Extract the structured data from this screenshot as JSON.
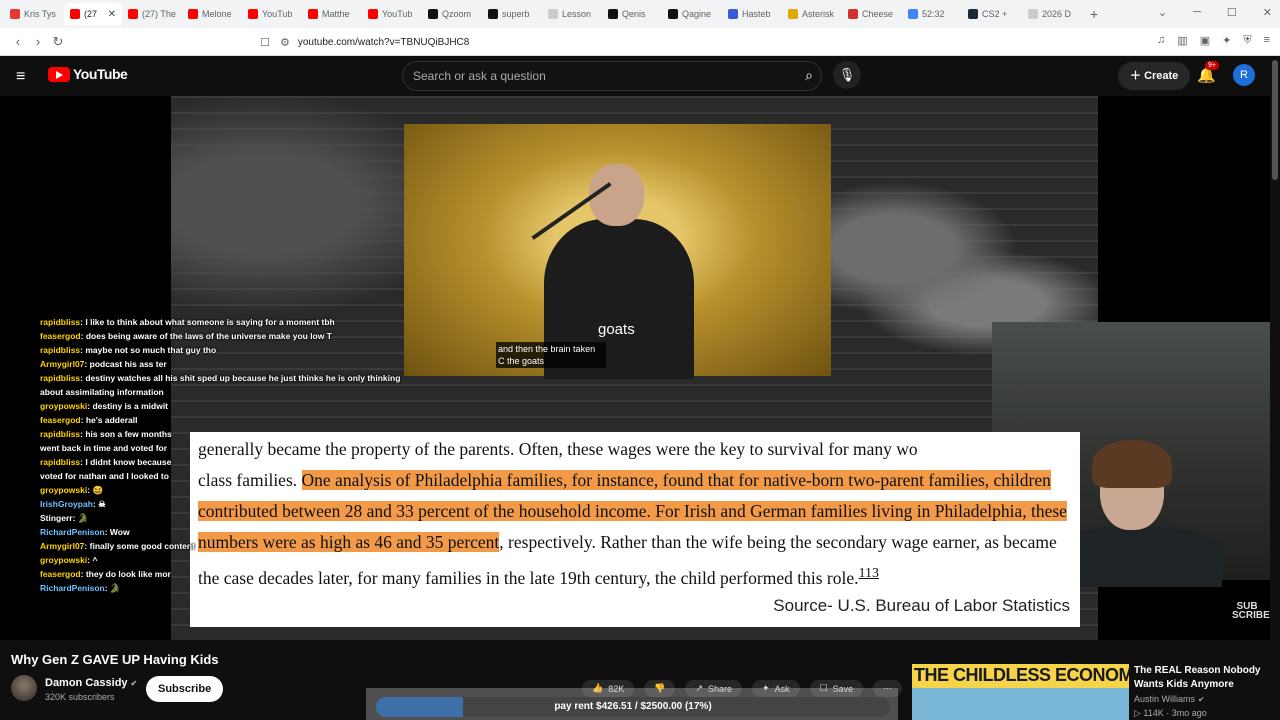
{
  "browser": {
    "tabs": [
      {
        "label": "Kris Tys",
        "color": "#e53935"
      },
      {
        "label": "(27",
        "color": "#ff0000",
        "active": true
      },
      {
        "label": "(27) The",
        "color": "#ff0000"
      },
      {
        "label": "Melone",
        "color": "#ff0000"
      },
      {
        "label": "YouTub",
        "color": "#ff0000"
      },
      {
        "label": "Matthe",
        "color": "#ff0000"
      },
      {
        "label": "YouTub",
        "color": "#ff0000"
      },
      {
        "label": "Qzoom",
        "color": "#111111"
      },
      {
        "label": "superb",
        "color": "#111111"
      },
      {
        "label": "Lesson",
        "color": "#cccccc"
      },
      {
        "label": "Qenis",
        "color": "#111111"
      },
      {
        "label": "Qagine",
        "color": "#111111"
      },
      {
        "label": "Hasteb",
        "color": "#3a5bd9"
      },
      {
        "label": "Asterisk",
        "color": "#e0a800"
      },
      {
        "label": "Cheese",
        "color": "#d32f2f"
      },
      {
        "label": "52:32",
        "color": "#4285f4"
      },
      {
        "label": "CS2 +",
        "color": "#1b2838"
      },
      {
        "label": "2026 D",
        "color": "#cccccc"
      }
    ],
    "url": "youtube.com/watch?v=TBNUQiBJHC8"
  },
  "header": {
    "logo": "YouTube",
    "search_placeholder": "Search or ask a question",
    "create_label": "Create",
    "notif_badge": "9+",
    "avatar_letter": "R"
  },
  "player": {
    "caption_word": "goats",
    "caption_small": "and then the brain taken C the goats",
    "doc": {
      "line1": "generally became the property of the parents. Often, these wages were the key to survival for many wo",
      "line2_pre": "class families. ",
      "highlight": "One analysis of Philadelphia families, for instance, found that for native-born two-parent families, children contributed between 28 and 33 percent of the household income. For Irish and German families living in Philadelphia, these numbers were as high as 46 and 35 percent",
      "post": ", respectively. Rather than the wife being the secondary wage earner, as became the case decades later, for many families in the late 19th century, the child performed this role.",
      "footnote": "113",
      "source": "Source- U.S. Bureau of Labor Statistics"
    },
    "watermark": "SUB SCRIBE"
  },
  "chat": [
    {
      "user": "rapidbliss",
      "color": "#ffd400",
      "text": "I like to think about what someone is saying for a moment tbh"
    },
    {
      "user": "feasergod",
      "color": "#ffd400",
      "text": "does being aware of the laws of the universe make you low T"
    },
    {
      "user": "rapidbliss",
      "color": "#ffd400",
      "text": "maybe not so much that guy tho"
    },
    {
      "user": "Armygirl07",
      "color": "#ffd400",
      "text": "podcast his ass ter"
    },
    {
      "user": "rapidbliss",
      "color": "#ffd400",
      "text": "destiny watches all his shit sped up because he just thinks he is only thinking about assimilating information",
      "wrap": true
    },
    {
      "user": "groypowski",
      "color": "#ffd400",
      "text": "destiny is a midwit"
    },
    {
      "user": "feasergod",
      "color": "#ffd400",
      "text": "he's adderall"
    },
    {
      "user": "rapidbliss",
      "color": "#ffd400",
      "text": "his son a few months"
    },
    {
      "user": "",
      "color": "#ffd400",
      "text": "went back in time and voted for"
    },
    {
      "user": "rapidbliss",
      "color": "#ffd400",
      "text": "I didnt know because"
    },
    {
      "user": "",
      "color": "#ffd400",
      "text": "voted for nathan and I looked to"
    },
    {
      "user": "groypowski",
      "color": "#ffd400",
      "text": "😆"
    },
    {
      "user": "IrishGroypah",
      "color": "#6ec1ff",
      "text": "☠"
    },
    {
      "user": "Stingerr",
      "color": "#ffffff",
      "text": "🐊"
    },
    {
      "user": "RichardPenison",
      "color": "#6ec1ff",
      "text": "Wow"
    },
    {
      "user": "Armygirl07",
      "color": "#ffd400",
      "text": "finally some good content"
    },
    {
      "user": "groypowski",
      "color": "#ffd400",
      "text": "^"
    },
    {
      "user": "feasergod",
      "color": "#ffd400",
      "text": "they do look like mor"
    },
    {
      "user": "RichardPenison",
      "color": "#6ec1ff",
      "text": "🐊"
    }
  ],
  "video": {
    "title": "Why Gen Z GAVE UP Having Kids",
    "channel": "Damon Cassidy",
    "subscribers": "320K subscribers",
    "subscribe_label": "Subscribe",
    "likes": "82K",
    "share_label": "Share",
    "ask_label": "Ask",
    "save_label": "Save"
  },
  "rent_overlay": {
    "text": "pay rent $426.51 / $2500.00 (17%)",
    "progress": 0.17
  },
  "recommendation": {
    "thumb_text": "THE CHILDLESS ECONOMY",
    "title": "The REAL Reason Nobody Wants Kids Anymore",
    "channel": "Austin Williams",
    "views": "114K",
    "age": "3mo ago"
  }
}
